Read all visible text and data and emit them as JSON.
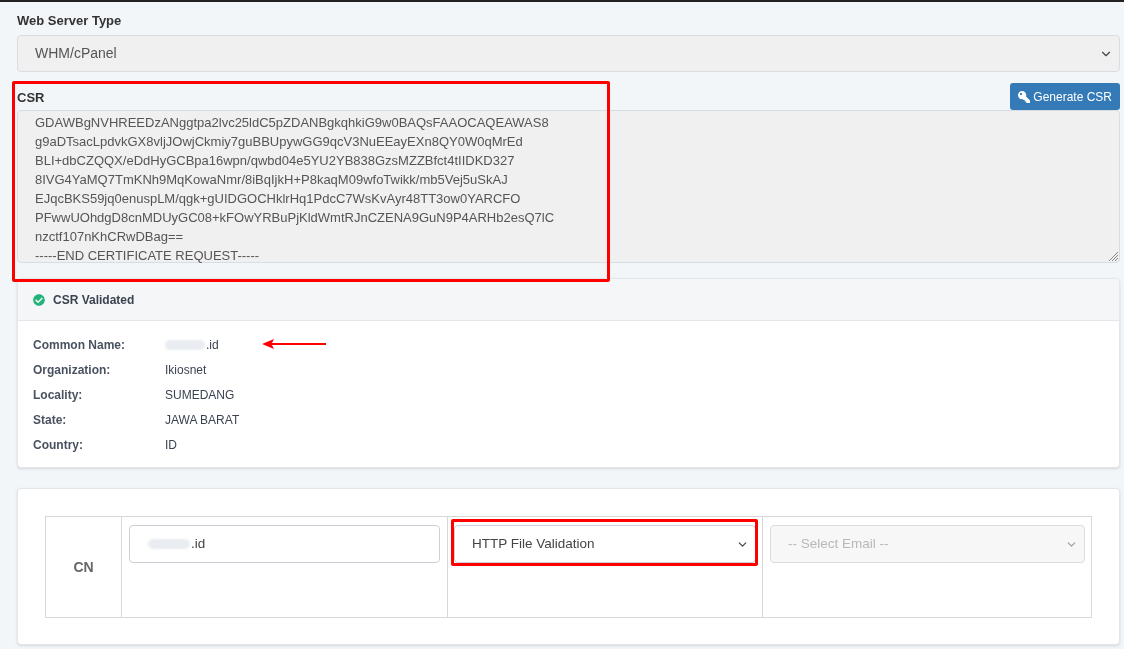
{
  "web_server_type": {
    "label": "Web Server Type",
    "value": "WHM/cPanel"
  },
  "csr": {
    "label": "CSR",
    "button": "Generate CSR",
    "value": "GDAWBgNVHREEDzANggtpa2lvc25ldC5pZDANBgkqhkiG9w0BAQsFAAOCAQEAWAS8\ng9aDTsacLpdvkGX8vljJOwjCkmiy7guBBUpywGG9qcV3NuEEayEXn8QY0W0qMrEd\nBLI+dbCZQQX/eDdHyGCBpa16wpn/qwbd04e5YU2YB838GzsMZZBfct4tIIDKD327\n8IVG4YaMQ7TmKNh9MqKowaNmr/8iBqIjkH+P8kaqM09wfoTwikk/mb5Vej5uSkAJ\nEJqcBKS59jq0enuspLM/qgk+gUIDGOCHklrHq1PdcC7WsKvAyr48TT3ow0YARCFO\nPFwwUOhdgD8cnMDUyGC08+kFOwYRBuPjKldWmtRJnCZENA9GuN9P4ARHb2esQ7lC\nnzctf107nKhCRwDBag==\n-----END CERTIFICATE REQUEST-----"
  },
  "validation": {
    "title": "CSR Validated",
    "validated": true,
    "fields": [
      {
        "label": "Common Name:",
        "value": ".id",
        "redacted": true
      },
      {
        "label": "Organization:",
        "value": "Ikiosnet",
        "redacted": false
      },
      {
        "label": "Locality:",
        "value": "SUMEDANG",
        "redacted": false
      },
      {
        "label": "State:",
        "value": "JAWA BARAT",
        "redacted": false
      },
      {
        "label": "Country:",
        "value": "ID",
        "redacted": false
      }
    ]
  },
  "domains": [
    {
      "label": "CN",
      "domain": ".id",
      "domain_redacted": true,
      "method": "HTTP File Validation",
      "email_placeholder": "-- Select Email --",
      "email_disabled": true
    }
  ]
}
